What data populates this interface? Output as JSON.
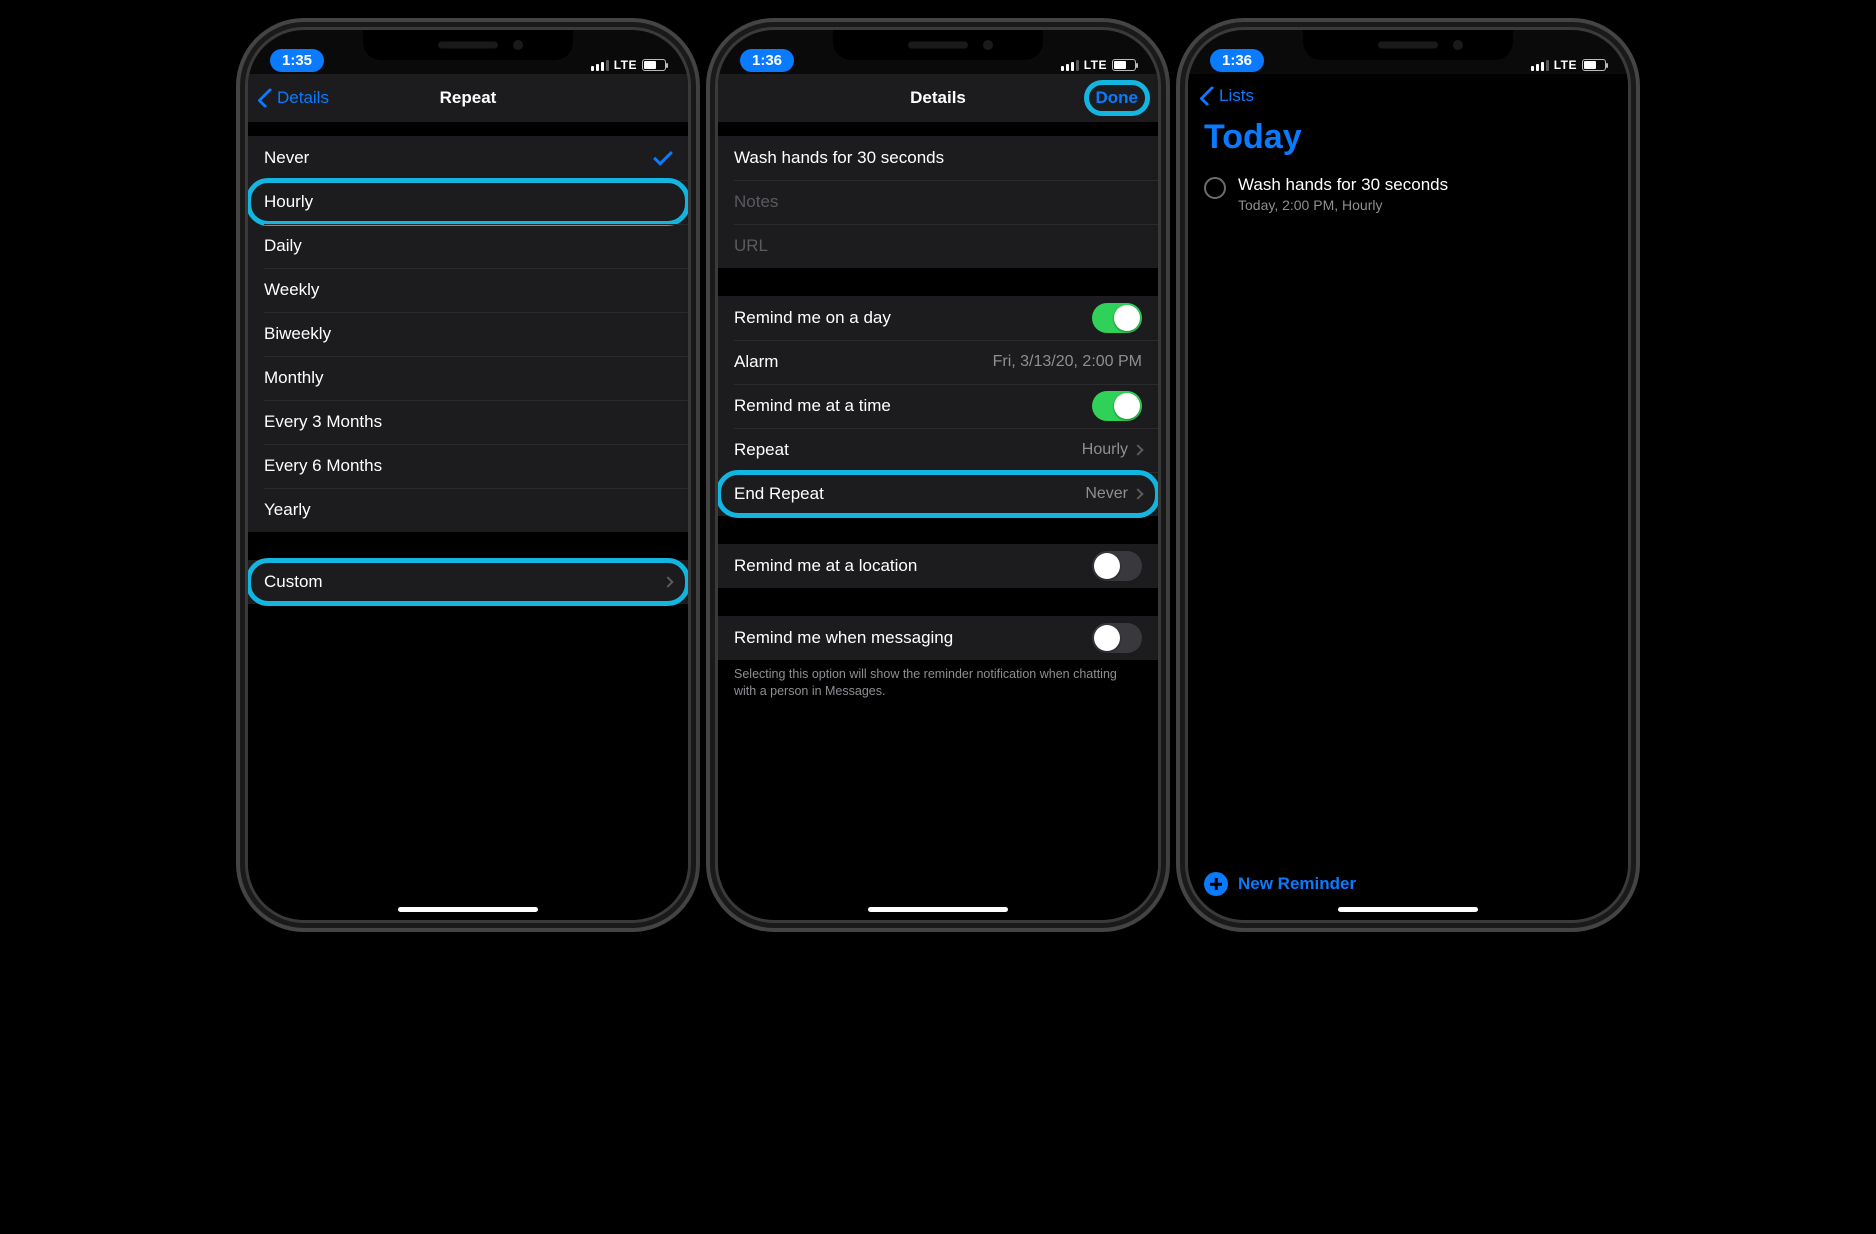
{
  "screens": {
    "s1": {
      "status_time": "1:35",
      "carrier": "LTE",
      "back_label": "Details",
      "title": "Repeat",
      "options": [
        {
          "label": "Never",
          "selected": true
        },
        {
          "label": "Hourly",
          "selected": false
        },
        {
          "label": "Daily",
          "selected": false
        },
        {
          "label": "Weekly",
          "selected": false
        },
        {
          "label": "Biweekly",
          "selected": false
        },
        {
          "label": "Monthly",
          "selected": false
        },
        {
          "label": "Every 3 Months",
          "selected": false
        },
        {
          "label": "Every 6 Months",
          "selected": false
        },
        {
          "label": "Yearly",
          "selected": false
        }
      ],
      "custom_label": "Custom"
    },
    "s2": {
      "status_time": "1:36",
      "carrier": "LTE",
      "title": "Details",
      "done_label": "Done",
      "reminder_title": "Wash hands for 30 seconds",
      "notes_placeholder": "Notes",
      "url_placeholder": "URL",
      "rows": {
        "remind_day": {
          "label": "Remind me on a day",
          "on": true
        },
        "alarm": {
          "label": "Alarm",
          "value": "Fri, 3/13/20, 2:00 PM"
        },
        "remind_time": {
          "label": "Remind me at a time",
          "on": true
        },
        "repeat": {
          "label": "Repeat",
          "value": "Hourly"
        },
        "end_repeat": {
          "label": "End Repeat",
          "value": "Never"
        },
        "remind_location": {
          "label": "Remind me at a location",
          "on": false
        },
        "remind_msg": {
          "label": "Remind me when messaging",
          "on": false
        }
      },
      "footnote": "Selecting this option will show the reminder notification when chatting with a person in Messages."
    },
    "s3": {
      "status_time": "1:36",
      "carrier": "LTE",
      "back_label": "Lists",
      "large_title": "Today",
      "reminder_title": "Wash hands for 30 seconds",
      "reminder_sub": "Today, 2:00 PM, Hourly",
      "new_reminder_label": "New Reminder"
    }
  },
  "colors": {
    "accent": "#0a7aff",
    "highlight": "#12b6e0",
    "toggle_on": "#30d158"
  }
}
